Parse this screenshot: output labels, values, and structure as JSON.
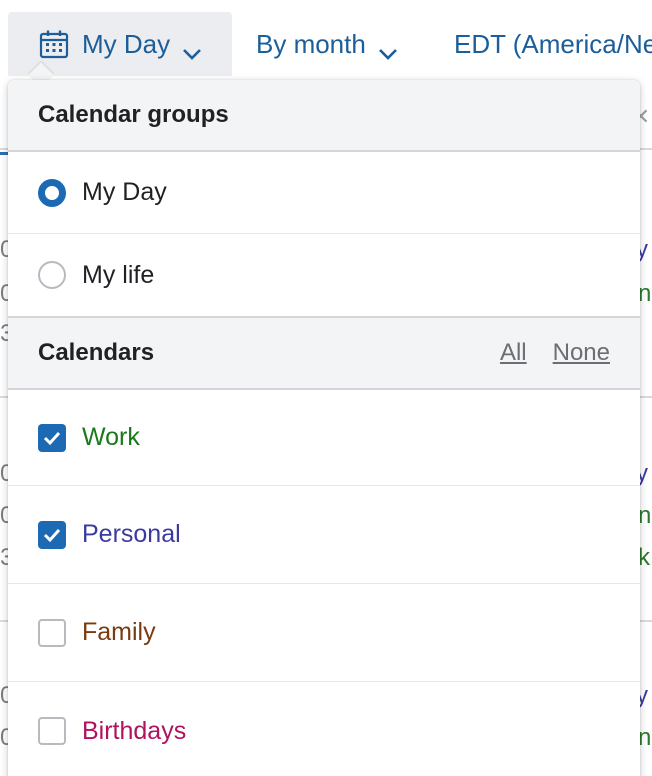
{
  "toolbar": {
    "my_day_label": "My Day",
    "by_month_label": "By month",
    "timezone_label": "EDT (America/New_York)"
  },
  "popover": {
    "groups_title": "Calendar groups",
    "groups": [
      {
        "label": "My Day",
        "selected": true
      },
      {
        "label": "My life",
        "selected": false
      }
    ],
    "calendars_title": "Calendars",
    "all_link": "All",
    "none_link": "None",
    "calendars": [
      {
        "label": "Work",
        "checked": true,
        "color": "#1a7a1a"
      },
      {
        "label": "Personal",
        "checked": true,
        "color": "#3b3aa3"
      },
      {
        "label": "Family",
        "checked": false,
        "color": "#7a3b0e"
      },
      {
        "label": "Birthdays",
        "checked": false,
        "color": "#b0125f"
      }
    ]
  },
  "colors": {
    "accent": "#1c6ab4",
    "toolbar_text": "#1c5e99",
    "active_tab_bg": "#ebedf0",
    "section_bg": "#f3f4f5"
  }
}
